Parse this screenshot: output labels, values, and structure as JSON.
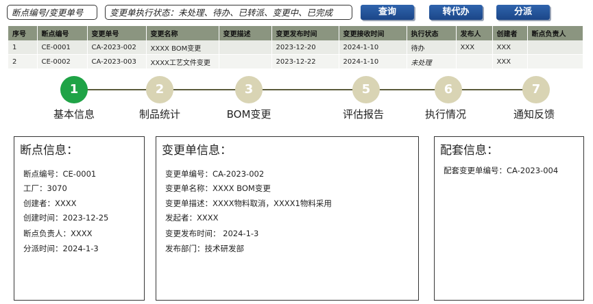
{
  "filters": {
    "breakpoint_or_change_no": "断点编号/变更单号",
    "status_options": "变更单执行状态：未处理、待办、已转派、变更中、已完成"
  },
  "buttons": {
    "query": "查询",
    "transfer": "转代办",
    "dispatch": "分派"
  },
  "table": {
    "columns": [
      "序号",
      "断点编号",
      "变更单号",
      "变更名称",
      "变更描述",
      "变更发布时间",
      "变更接收时间",
      "执行状态",
      "发布人",
      "创建者",
      "断点负责人"
    ],
    "rows": [
      [
        "1",
        "CE-0001",
        "CA-2023-002",
        "XXXX BOM变更",
        "",
        "2023-12-20",
        "2024-1-10",
        "待办",
        "XXX",
        "XXX",
        ""
      ],
      [
        "2",
        "CE-0002",
        "CA-2023-003",
        "XXXX工艺文件变更",
        "",
        "2023-12-22",
        "2024-1-10",
        "未处理",
        "",
        "XXX",
        ""
      ]
    ]
  },
  "steps": [
    {
      "number": "1",
      "label": "基本信息",
      "active": true
    },
    {
      "number": "2",
      "label": "制品统计",
      "active": false
    },
    {
      "number": "3",
      "label": "BOM变更",
      "active": false
    },
    {
      "number": "5",
      "label": "评估报告",
      "active": false
    },
    {
      "number": "6",
      "label": "执行情况",
      "active": false
    },
    {
      "number": "7",
      "label": "通知反馈",
      "active": false
    }
  ],
  "panels": {
    "breakpoint": {
      "title": "断点信息：",
      "fields": [
        "断点编号：CE-0001",
        "工厂：3070",
        "创建者：XXXX",
        "创建时间：2023-12-25",
        "断点负责人：XXXX",
        "分派时间：2024-1-3"
      ]
    },
    "change": {
      "title": "变更单信息：",
      "fields": [
        "变更单编号：CA-2023-002",
        "变更单名称：XXXX BOM变更",
        "变更单描述：XXXX物料取消，XXXX1物料采用",
        "发起者：XXXX",
        "变更发布时间：  2024-1-3",
        "发布部门：技术研发部"
      ]
    },
    "match": {
      "title": "配套信息：",
      "fields": [
        "配套变更单编号：CA-2023-004"
      ]
    }
  },
  "colors": {
    "button": "#1b4688",
    "table_header": "#8b9580",
    "step_active": "#1fa346",
    "step_inactive": "#d9d4b4"
  }
}
